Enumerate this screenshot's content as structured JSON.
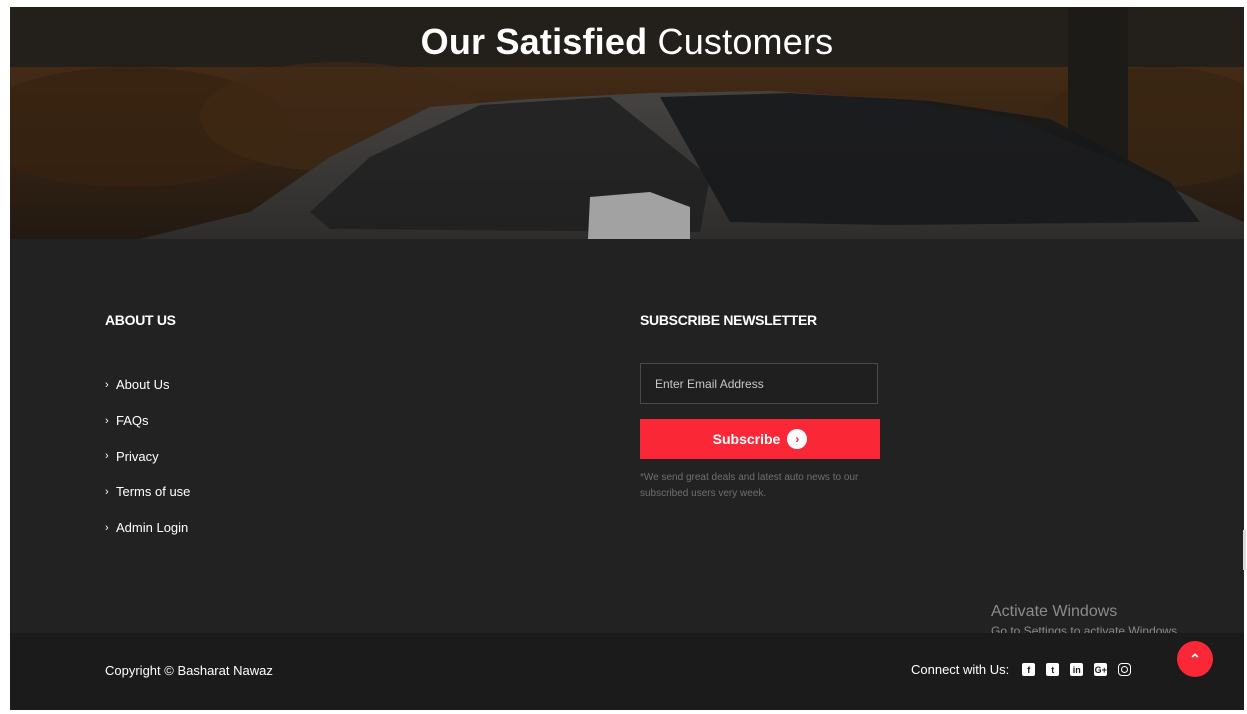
{
  "hero": {
    "title_bold": "Our Satisfied",
    "title_light": "Customers"
  },
  "about": {
    "title": "ABOUT US",
    "links": [
      "About Us",
      "FAQs",
      "Privacy",
      "Terms of use",
      "Admin Login"
    ]
  },
  "newsletter": {
    "title": "SUBSCRIBE NEWSLETTER",
    "placeholder": "Enter Email Address",
    "button_label": "Subscribe",
    "note": "*We send great deals and latest auto news to our subscribed users very week."
  },
  "watermark": {
    "line1": "Activate Windows",
    "line2": "Go to Settings to activate Windows."
  },
  "footer": {
    "copyright": "Copyright © Basharat Nawaz",
    "connect_label": "Connect with Us:",
    "social_icons": [
      "facebook-icon",
      "twitter-icon",
      "linkedin-icon",
      "google-plus-icon",
      "instagram-icon"
    ]
  },
  "colors": {
    "accent": "#fa2837",
    "footer_bg": "#222222",
    "bottom_bar_bg": "#1b1b1b"
  }
}
